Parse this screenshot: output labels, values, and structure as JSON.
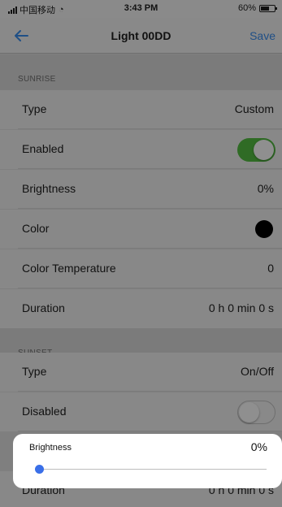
{
  "status_bar": {
    "carrier": "中国移动",
    "time": "3:43 PM",
    "battery": "60%",
    "battery_level": 0.6
  },
  "nav": {
    "title": "Light 00DD",
    "save_label": "Save",
    "back_icon": "arrow-left-icon",
    "accent_color": "#1f4f86"
  },
  "sunrise": {
    "header": "SUNRISE",
    "rows": [
      {
        "label": "Type",
        "value": "Custom"
      },
      {
        "label": "Enabled",
        "toggle": true
      },
      {
        "label": "Brightness",
        "value": "0%"
      },
      {
        "label": "Color",
        "swatch": "#000000"
      },
      {
        "label": "Color Temperature",
        "value": "0"
      },
      {
        "label": "Duration",
        "value": "0 h 0 min 0 s"
      }
    ]
  },
  "sunset": {
    "header": "SUNSET",
    "rows": [
      {
        "label": "Type",
        "value": "On/Off"
      },
      {
        "label": "Disabled",
        "toggle": false
      },
      {
        "label": "Duration",
        "value": "0 h 0 min 0 s"
      }
    ]
  },
  "brightness_popup": {
    "label": "Brightness",
    "value": "0%",
    "slider_value": 0,
    "thumb_color": "#3a6fe8"
  }
}
